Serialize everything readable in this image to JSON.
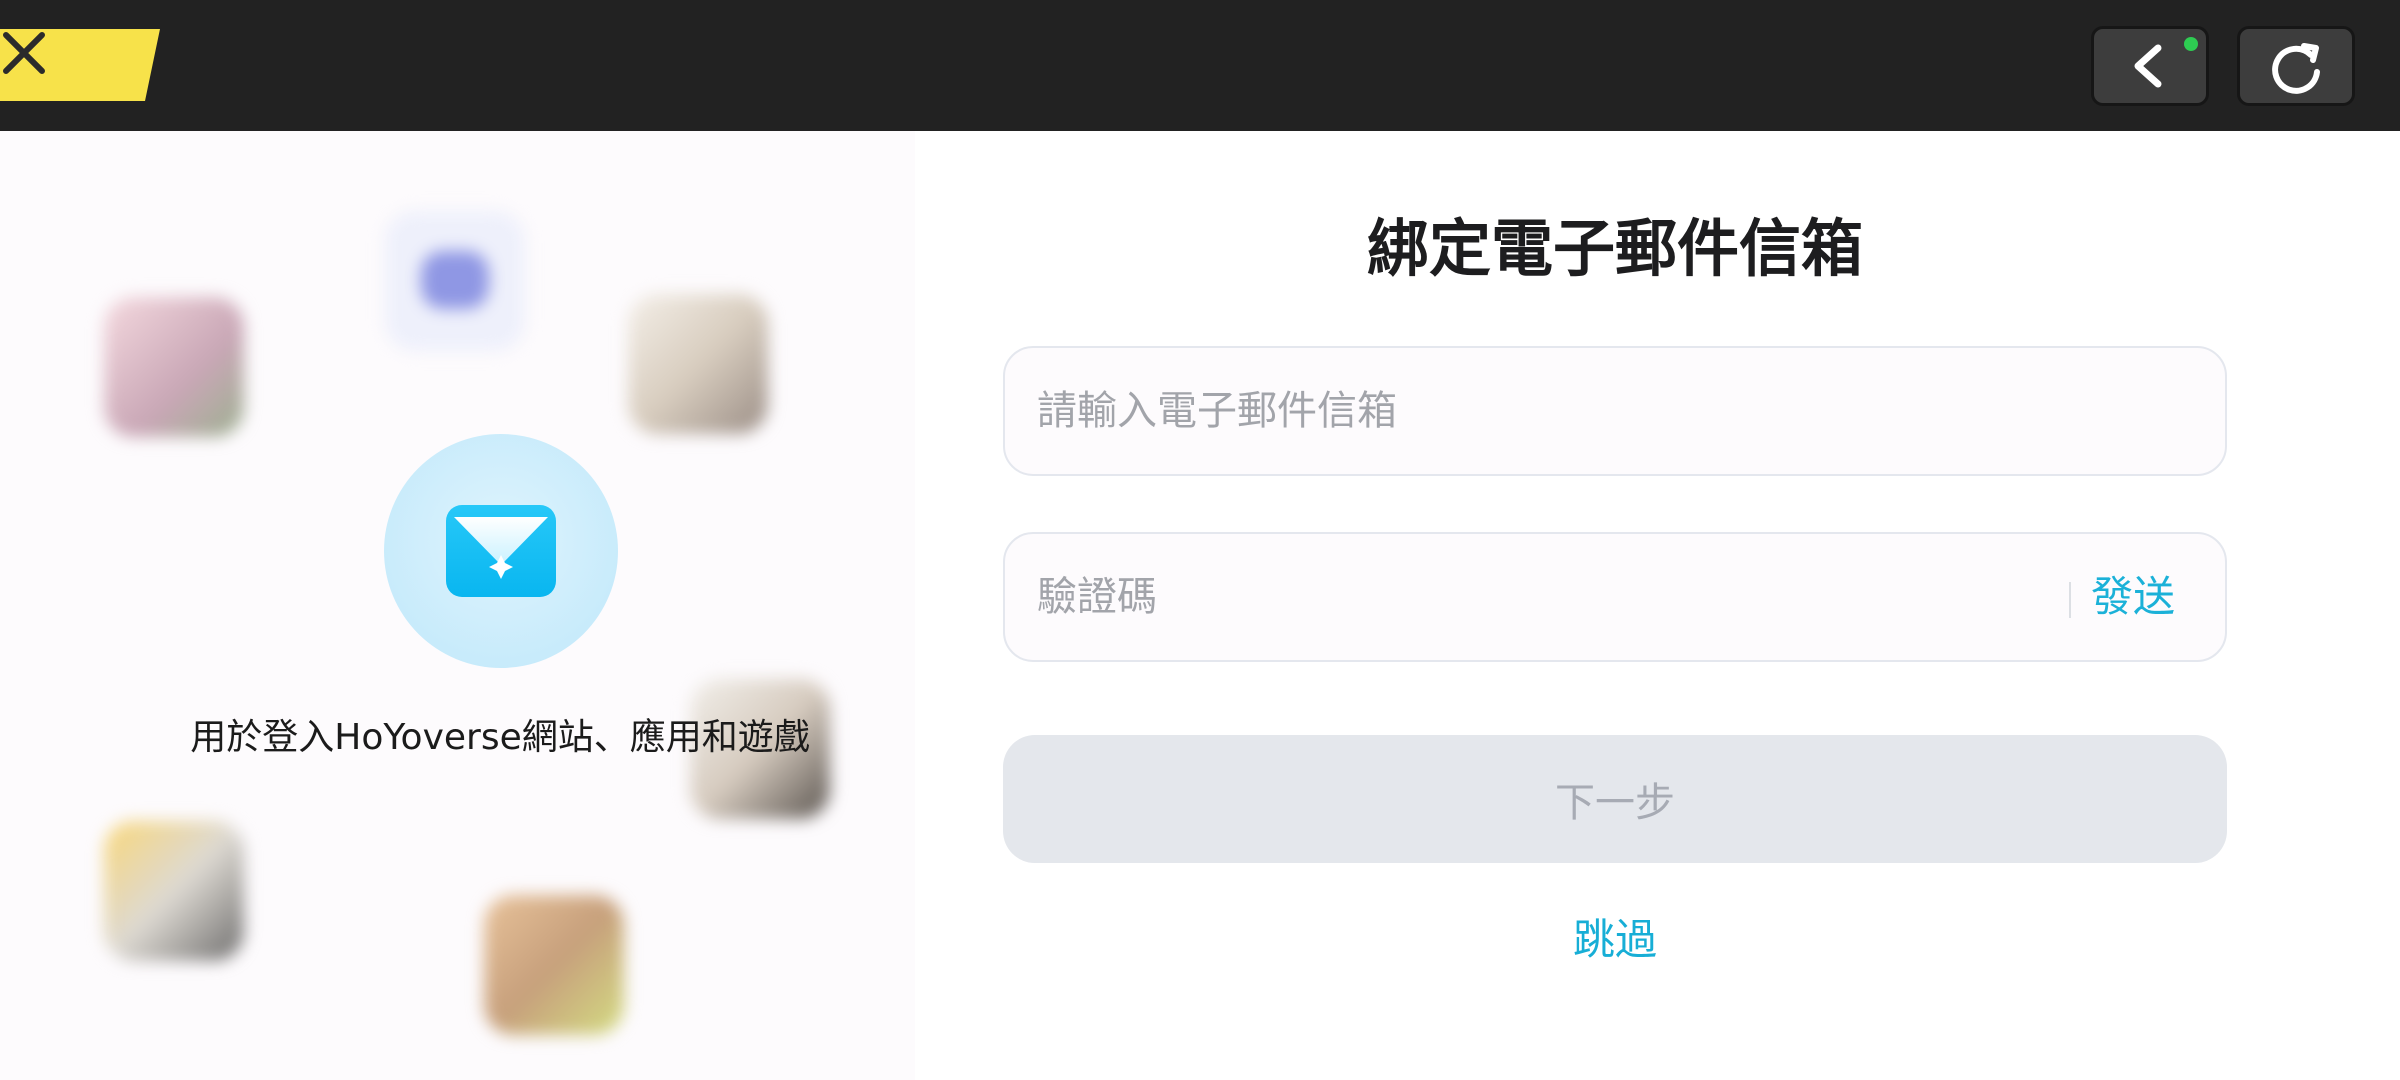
{
  "topbar": {
    "close_icon": "close-icon",
    "back_icon": "chevron-left-icon",
    "refresh_icon": "refresh-icon",
    "status_dot_color": "#2ecc52",
    "accent_color": "#f7e24a"
  },
  "left": {
    "caption": "用於登入HoYoverse網站、應用和遊戲",
    "center_icon": "mail-icon"
  },
  "form": {
    "title": "綁定電子郵件信箱",
    "email_placeholder": "請輸入電子郵件信箱",
    "code_placeholder": "驗證碼",
    "send_label": "發送",
    "next_label": "下一步",
    "skip_label": "跳過",
    "accent_color": "#1bb1d8"
  }
}
